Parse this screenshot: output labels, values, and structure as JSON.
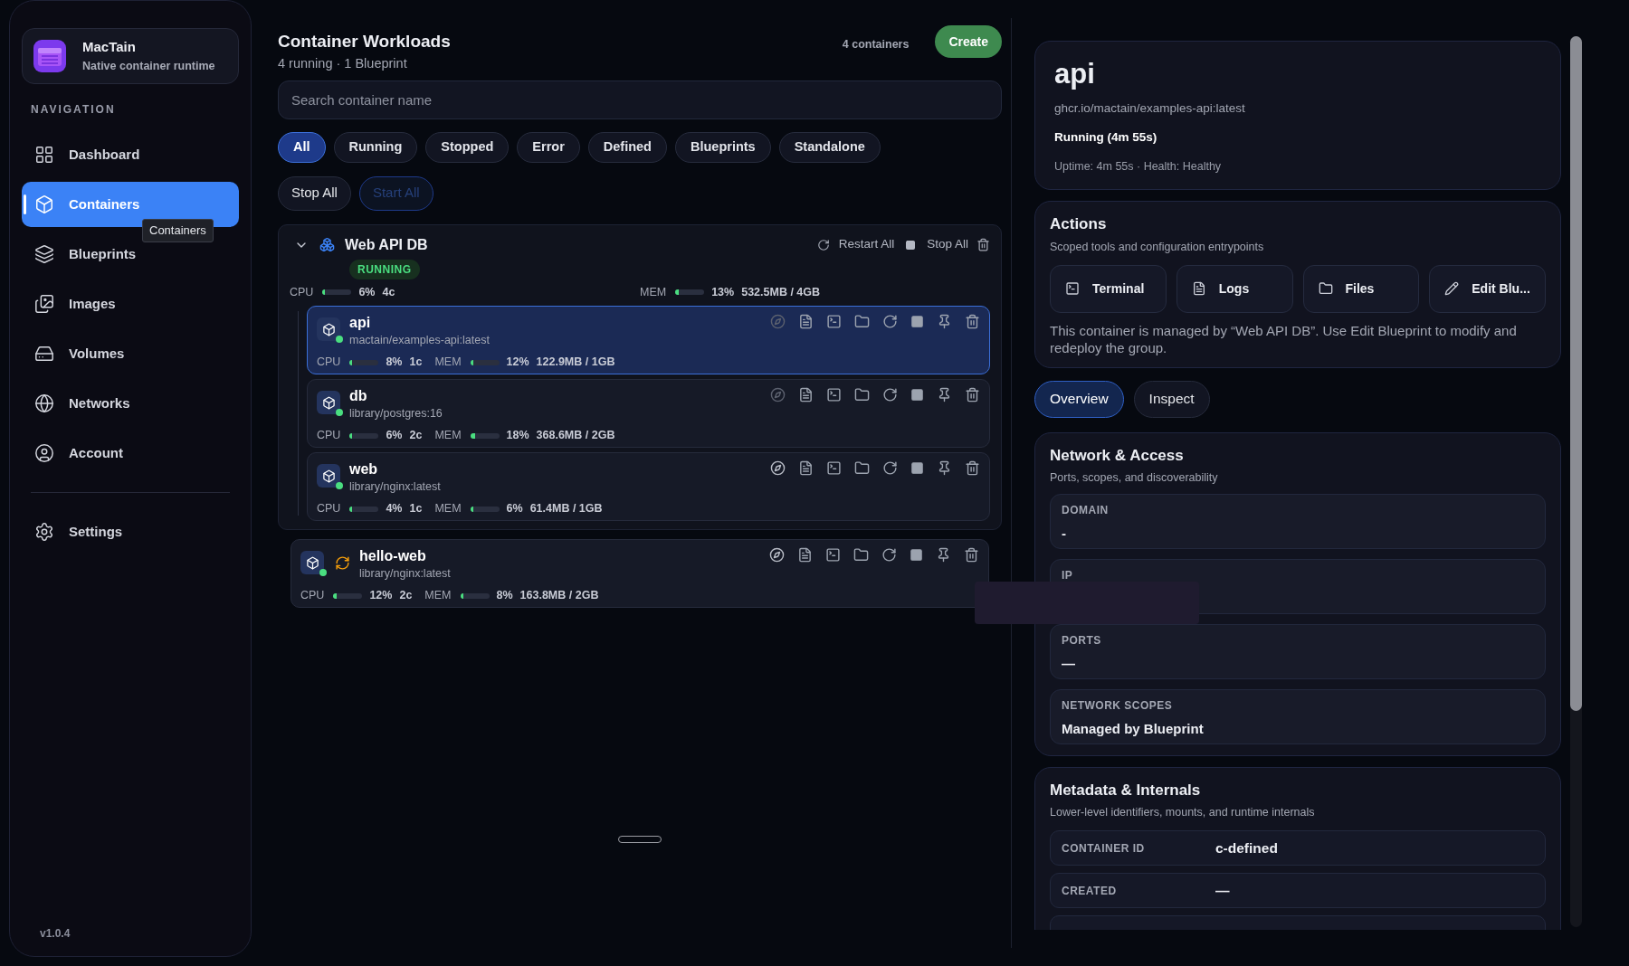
{
  "app": {
    "name": "MacTain",
    "tagline": "Native container runtime",
    "version": "v1.0.4"
  },
  "sidebar": {
    "section": "NAVIGATION",
    "items": [
      {
        "kind": "dashboard",
        "label": "Dashboard",
        "selected": false
      },
      {
        "kind": "containers",
        "label": "Containers",
        "selected": true
      },
      {
        "kind": "blueprints",
        "label": "Blueprints",
        "selected": false
      },
      {
        "kind": "images",
        "label": "Images",
        "selected": false
      },
      {
        "kind": "volumes",
        "label": "Volumes",
        "selected": false
      },
      {
        "kind": "networks",
        "label": "Networks",
        "selected": false
      },
      {
        "kind": "account",
        "label": "Account",
        "selected": false
      }
    ],
    "footer_items": [
      {
        "kind": "settings",
        "label": "Settings",
        "selected": false
      }
    ],
    "tooltip": "Containers"
  },
  "header": {
    "title": "Container Workloads",
    "subtitle": "4 running · 1 Blueprint",
    "count": "4 containers",
    "create": "Create"
  },
  "search": {
    "placeholder": "Search container name"
  },
  "filters": [
    {
      "label": "All",
      "selected": true
    },
    {
      "label": "Running",
      "selected": false
    },
    {
      "label": "Stopped",
      "selected": false
    },
    {
      "label": "Error",
      "selected": false
    },
    {
      "label": "Defined",
      "selected": false
    },
    {
      "label": "Blueprints",
      "selected": false
    },
    {
      "label": "Standalone",
      "selected": false
    }
  ],
  "bulk": [
    {
      "label": "Stop All",
      "disabled": false
    },
    {
      "label": "Start All",
      "disabled": true
    }
  ],
  "group": {
    "name": "Web API DB",
    "expanded": true,
    "status": "RUNNING",
    "restart": "Restart All",
    "stop": "Stop All",
    "cpu": {
      "label": "CPU",
      "level": 0.06,
      "reading": "6%",
      "extra": "4c"
    },
    "mem": {
      "label": "MEM",
      "level": 0.13,
      "reading": "13%",
      "extra": "532.5MB / 4GB"
    },
    "containers": [
      {
        "name": "api",
        "image": "mactain/examples-api:latest",
        "selected": true,
        "running": true,
        "open_disabled": true,
        "cpu": {
          "label": "CPU",
          "level": 0.08,
          "reading": "8%",
          "extra": "1c"
        },
        "mem": {
          "label": "MEM",
          "level": 0.12,
          "reading": "12%",
          "extra": "122.9MB / 1GB"
        }
      },
      {
        "name": "db",
        "image": "library/postgres:16",
        "selected": false,
        "running": true,
        "open_disabled": true,
        "cpu": {
          "label": "CPU",
          "level": 0.06,
          "reading": "6%",
          "extra": "2c"
        },
        "mem": {
          "label": "MEM",
          "level": 0.18,
          "reading": "18%",
          "extra": "368.6MB / 2GB"
        }
      },
      {
        "name": "web",
        "image": "library/nginx:latest",
        "selected": false,
        "running": true,
        "open_disabled": false,
        "cpu": {
          "label": "CPU",
          "level": 0.04,
          "reading": "4%",
          "extra": "1c"
        },
        "mem": {
          "label": "MEM",
          "level": 0.06,
          "reading": "6%",
          "extra": "61.4MB / 1GB"
        }
      }
    ]
  },
  "standalone": [
    {
      "name": "hello-web",
      "image": "library/nginx:latest",
      "selected": false,
      "running": true,
      "warning": true,
      "open_disabled": false,
      "cpu": {
        "label": "CPU",
        "level": 0.12,
        "reading": "12%",
        "extra": "2c"
      },
      "mem": {
        "label": "MEM",
        "level": 0.08,
        "reading": "8%",
        "extra": "163.8MB / 2GB"
      }
    }
  ],
  "detail": {
    "title": "api",
    "image": "ghcr.io/mactain/examples-api:latest",
    "status": "Running (4m 55s)",
    "meta": "Uptime: 4m 55s · Health: Healthy",
    "actions": {
      "title": "Actions",
      "subtitle": "Scoped tools and configuration entrypoints",
      "buttons": [
        {
          "kind": "terminal",
          "label": "Terminal"
        },
        {
          "kind": "logs",
          "label": "Logs"
        },
        {
          "kind": "files",
          "label": "Files"
        },
        {
          "kind": "edit",
          "label": "Edit Blu..."
        }
      ],
      "note": "This container is managed by “Web API DB”. Use Edit Blueprint to modify and redeploy the group."
    },
    "tabs": [
      {
        "label": "Overview",
        "selected": true
      },
      {
        "label": "Inspect",
        "selected": false
      }
    ],
    "network": {
      "title": "Network & Access",
      "subtitle": "Ports, scopes, and discoverability",
      "fields": [
        {
          "label": "DOMAIN",
          "value": "-"
        },
        {
          "label": "IP"
        },
        {
          "label": "PORTS",
          "value": "—"
        },
        {
          "label": "NETWORK SCOPES",
          "value": "Managed by Blueprint"
        }
      ]
    },
    "metadata": {
      "title": "Metadata & Internals",
      "subtitle": "Lower-level identifiers, mounts, and runtime internals",
      "rows": [
        {
          "label": "CONTAINER ID",
          "value": "c-defined"
        },
        {
          "label": "CREATED",
          "value": "—"
        }
      ]
    }
  }
}
